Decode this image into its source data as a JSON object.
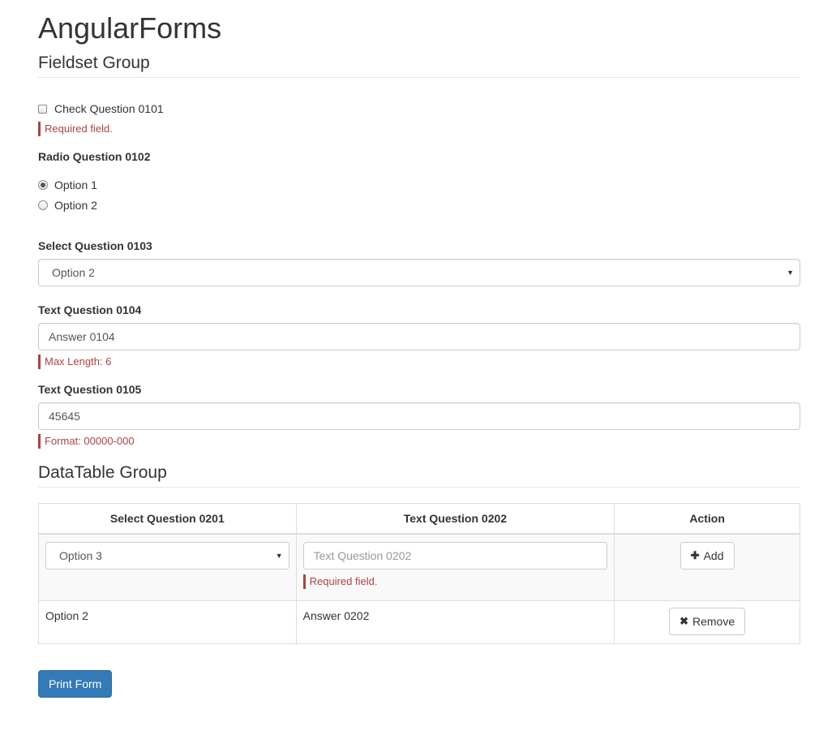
{
  "app_title": "AngularForms",
  "fieldset_group": {
    "title": "Fieldset Group",
    "check_question": {
      "label": "Check Question 0101",
      "checked": false,
      "error": "Required field."
    },
    "radio_question": {
      "label": "Radio Question 0102",
      "options": [
        {
          "label": "Option 1",
          "selected": true
        },
        {
          "label": "Option 2",
          "selected": false
        }
      ]
    },
    "select_question": {
      "label": "Select Question 0103",
      "value": "Option 2"
    },
    "text_question_0104": {
      "label": "Text Question 0104",
      "value": "Answer 0104",
      "error": "Max Length: 6"
    },
    "text_question_0105": {
      "label": "Text Question 0105",
      "value": "45645",
      "error": "Format: 00000-000"
    }
  },
  "datatable_group": {
    "title": "DataTable Group",
    "columns": [
      "Select Question 0201",
      "Text Question 0202",
      "Action"
    ],
    "add_row": {
      "select_value": "Option 3",
      "text_placeholder": "Text Question 0202",
      "text_error": "Required field.",
      "add_label": "Add",
      "add_icon": "plus-icon"
    },
    "rows": [
      {
        "select_value": "Option 2",
        "text_value": "Answer 0202",
        "remove_label": "Remove",
        "remove_icon": "times-icon"
      }
    ]
  },
  "print_button_label": "Print Form",
  "colors": {
    "error": "#a94442",
    "primary": "#337ab7",
    "border": "#cccccc"
  }
}
